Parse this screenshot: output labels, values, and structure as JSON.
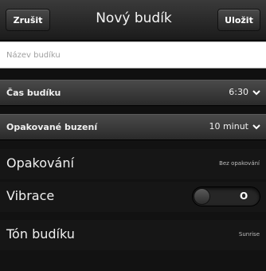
{
  "titlebar": {
    "cancel_label": "Zrušit",
    "title": "Nový budík",
    "save_label": "Uložit"
  },
  "name_field": {
    "value": "",
    "placeholder": "Název budíku"
  },
  "alarm_time": {
    "label": "Čas budíku",
    "value": "6:30"
  },
  "snooze": {
    "label": "Opakované buzení",
    "value": "10 minut"
  },
  "repeat": {
    "label": "Opakování",
    "value": "Bez opakování"
  },
  "vibration": {
    "label": "Vibrace",
    "state_label": "O",
    "on": false
  },
  "tone": {
    "label": "Tón budíku",
    "value": "Sunrise"
  },
  "colors": {
    "background": "#121212",
    "header_bar": "#3a3a3a",
    "text": "#ffffff"
  }
}
